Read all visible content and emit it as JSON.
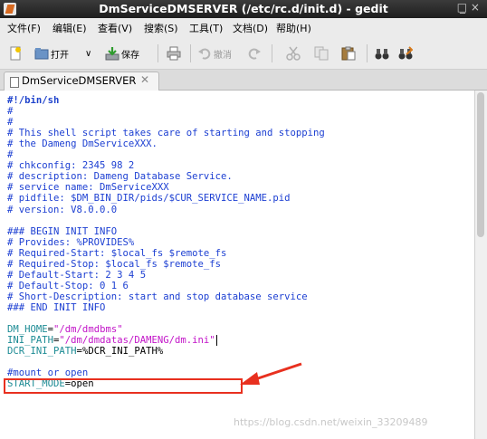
{
  "window": {
    "title": "DmServiceDMSERVER (/etc/rc.d/init.d) - gedit",
    "min": "_",
    "close": "□ ×"
  },
  "menu": [
    {
      "label": "文件(F)"
    },
    {
      "label": "编辑(E)"
    },
    {
      "label": "查看(V)"
    },
    {
      "label": "搜索(S)"
    },
    {
      "label": "工具(T)"
    },
    {
      "label": "文档(D)"
    },
    {
      "label": "帮助(H)"
    }
  ],
  "toolbar": {
    "open_label": "打开",
    "open_arrow": "∨",
    "save_label": "保存",
    "undo_label": "撤消"
  },
  "tab": {
    "label": "DmServiceDMSERVER",
    "close": "✕"
  },
  "editor": {
    "lines": [
      {
        "t": "#!/bin/sh",
        "k": "shebang"
      },
      {
        "t": "#",
        "k": "comment"
      },
      {
        "t": "#",
        "k": "comment"
      },
      {
        "t": "# This shell script takes care of starting and stopping",
        "k": "comment"
      },
      {
        "t": "# the Dameng DmServiceXXX.",
        "k": "comment"
      },
      {
        "t": "#",
        "k": "comment"
      },
      {
        "t": "# chkconfig: 2345 98 2",
        "k": "comment"
      },
      {
        "t": "# description: Dameng Database Service.",
        "k": "comment"
      },
      {
        "t": "# service name: DmServiceXXX",
        "k": "comment"
      },
      {
        "t": "# pidfile: $DM_BIN_DIR/pids/$CUR_SERVICE_NAME.pid",
        "k": "comment"
      },
      {
        "t": "# version: V8.0.0.0",
        "k": "comment"
      },
      {
        "t": "",
        "k": "plain"
      },
      {
        "t": "### BEGIN INIT INFO",
        "k": "comment"
      },
      {
        "t": "# Provides: %PROVIDES%",
        "k": "comment"
      },
      {
        "t": "# Required-Start: $local_fs $remote_fs",
        "k": "comment"
      },
      {
        "t": "# Required-Stop: $local_fs $remote_fs",
        "k": "comment"
      },
      {
        "t": "# Default-Start: 2 3 4 5",
        "k": "comment"
      },
      {
        "t": "# Default-Stop: 0 1 6",
        "k": "comment"
      },
      {
        "t": "# Short-Description: start and stop database service",
        "k": "comment"
      },
      {
        "t": "### END INIT INFO",
        "k": "comment"
      },
      {
        "t": "",
        "k": "plain"
      },
      {
        "t": "DM_HOME=\"/dm/dmdbms\"",
        "k": "assign",
        "name": "DM_HOME",
        "val": "\"/dm/dmdbms\""
      },
      {
        "t": "INI_PATH=\"/dm/dmdatas/DAMENG/dm.ini\"",
        "k": "assign",
        "name": "INI_PATH",
        "val": "\"/dm/dmdatas/DAMENG/dm.ini\""
      },
      {
        "t": "DCR_INI_PATH=%DCR_INI_PATH%",
        "k": "assign2",
        "name": "DCR_INI_PATH",
        "val": "%DCR_INI_PATH%"
      },
      {
        "t": "",
        "k": "plain"
      },
      {
        "t": "#mount or open",
        "k": "comment"
      },
      {
        "t": "START_MODE=open",
        "k": "assign2",
        "name": "START_MODE",
        "val": "open"
      }
    ]
  },
  "watermark": "https://blog.csdn.net/weixin_33209489",
  "colors": {
    "annotation": "#e8301f",
    "comment": "#1c3fd2",
    "string": "#c214c8",
    "identifier": "#1c8b94"
  }
}
